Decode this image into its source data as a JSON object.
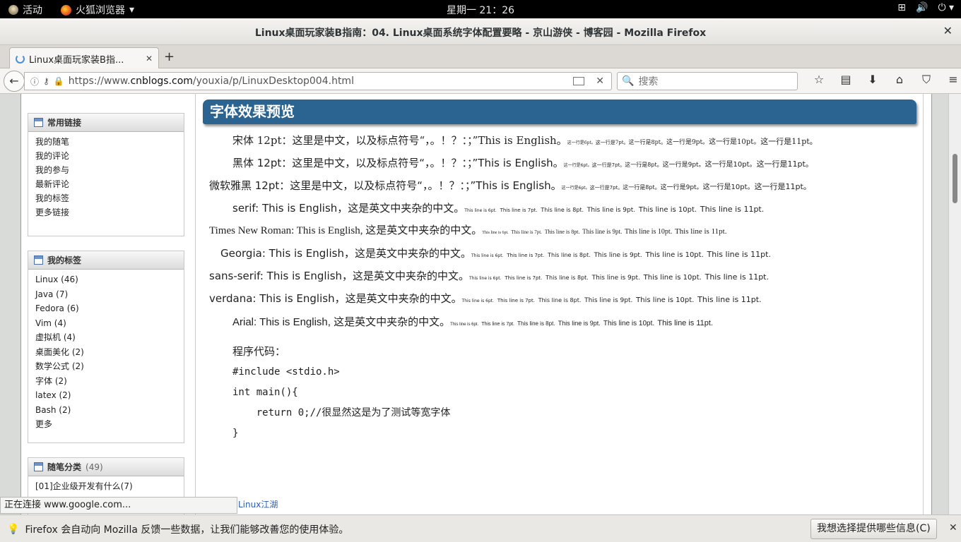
{
  "topbar": {
    "activities": "活动",
    "app_name": "火狐浏览器",
    "clock": "星期一  21：26"
  },
  "window": {
    "title": "Linux桌面玩家装B指南：04. Linux桌面系统字体配置要略 - 京山游侠 - 博客园 - Mozilla Firefox"
  },
  "tab": {
    "label": "Linux桌面玩家装B指..."
  },
  "navbar": {
    "url_prefix": "https://www.",
    "url_domain": "cnblogs.com",
    "url_path": "/youxia/p/LinuxDesktop004.html",
    "search_placeholder": "搜索"
  },
  "sidebar": {
    "links_title": "常用链接",
    "links": [
      "我的随笔",
      "我的评论",
      "我的参与",
      "最新评论",
      "我的标签",
      "更多链接"
    ],
    "tags_title": "我的标签",
    "tags": [
      "Linux (46)",
      "Java (7)",
      "Fedora (6)",
      "Vim (4)",
      "虚拟机 (4)",
      "桌面美化 (2)",
      "数学公式 (2)",
      "字体 (2)",
      "latex (2)",
      "Bash (2)",
      "更多"
    ],
    "categories_title": "随笔分类",
    "categories_count": "(49)",
    "categories": [
      "[01]企业级开发有什么(7)"
    ]
  },
  "post": {
    "heading": "字体效果预览",
    "song_main": "宋体 12pt：这里是中文，以及标点符号“，。！？：；”This is English。",
    "hei_main": "黑体 12pt：这里是中文，以及标点符号“，。！？：；”This is English。",
    "yahei_main": "微软雅黑 12pt：这里是中文，以及标点符号“，。！？：；”This is English。",
    "cn6": "这一行是6pt。",
    "cn7": "这一行是7pt。",
    "cn8": "这一行是8pt。",
    "cn9": "这一行是9pt。",
    "cn10": "这一行是10pt。",
    "cn11": "这一行是11pt。",
    "serif_main": "serif: This is English，这是英文中夹杂的中文。",
    "tnr_main": "Times New Roman: This is English, 这是英文中夹杂的中文。",
    "georgia_main": "Georgia: This is English，这是英文中夹杂的中文。",
    "sans_main": "sans-serif: This is English，这是英文中夹杂的中文。",
    "verdana_main": "verdana: This is English，这是英文中夹杂的中文。",
    "arial_main": "Arial: This is English, 这是英文中夹杂的中文。",
    "en6": "This line is 6pt.",
    "en7": "This line is 7pt.",
    "en8": "This line is 8pt.",
    "en9": "This line is 9pt.",
    "en10": "This line is 10pt.",
    "en11": "This line is 11pt.",
    "code_label": "程序代码：",
    "code": [
      "#include <stdio.h>",
      "int main(){",
      "    return 0;//很显然这是为了测试等宽字体",
      "}"
    ],
    "bottom_link": "Linux江湖"
  },
  "status": "正在连接 www.google.com...",
  "notification": {
    "message": "Firefox 会自动向 Mozilla 反馈一些数据，让我们能够改善您的使用体验。",
    "button": "我想选择提供哪些信息(C)"
  }
}
